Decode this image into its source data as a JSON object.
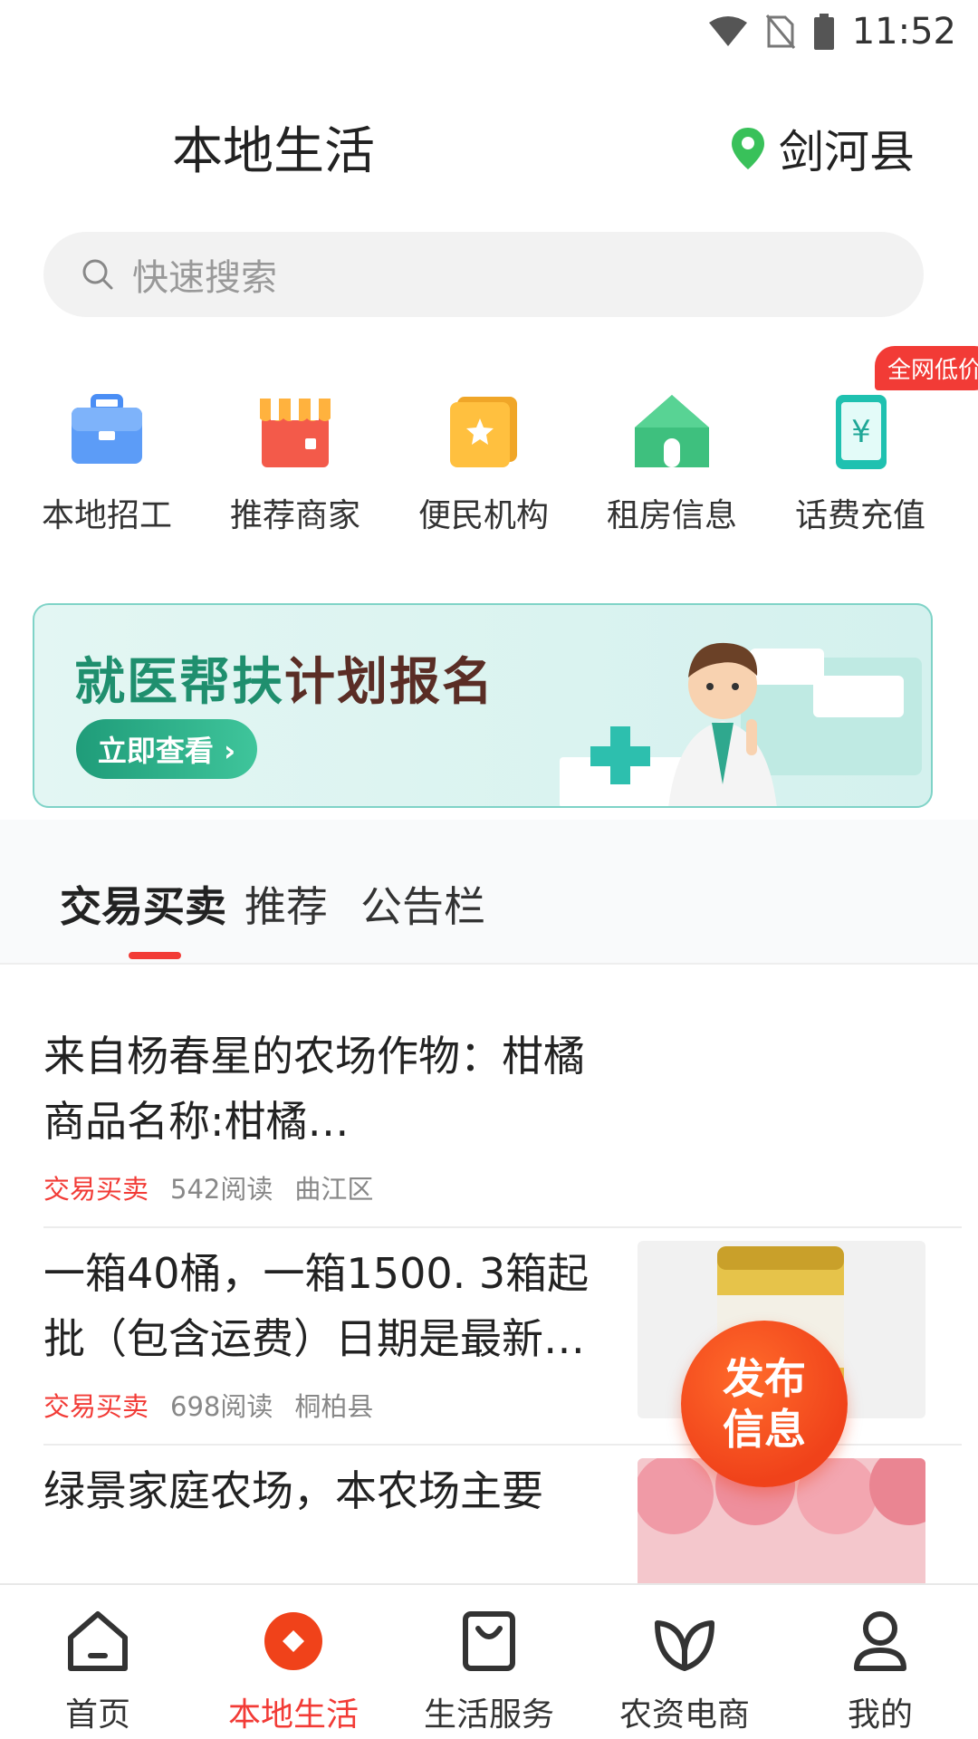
{
  "status_bar": {
    "time": "11:52"
  },
  "header": {
    "title": "本地生活",
    "location": "剑河县"
  },
  "search": {
    "placeholder": "快速搜索"
  },
  "quick_links": [
    {
      "label": "本地招工",
      "icon": "briefcase-icon"
    },
    {
      "label": "推荐商家",
      "icon": "storefront-icon"
    },
    {
      "label": "便民机构",
      "icon": "star-bookmark-icon"
    },
    {
      "label": "租房信息",
      "icon": "house-icon"
    },
    {
      "label": "话费充值",
      "icon": "phone-yuan-icon",
      "badge": "全网低价"
    }
  ],
  "banner": {
    "title_part1": "就医帮扶",
    "title_part2": "计划报名",
    "button": "立即查看 ›"
  },
  "tabs": [
    {
      "label": "交易买卖",
      "active": true
    },
    {
      "label": "推荐",
      "active": false
    },
    {
      "label": "公告栏",
      "active": false
    }
  ],
  "feed": [
    {
      "title": "来自杨春星的农场作物：柑橘商品名称:柑橘…",
      "tag": "交易买卖",
      "reads": "542阅读",
      "location": "曲江区"
    },
    {
      "title": "一箱40桶，一箱1500. 3箱起批（包含运费）日期是最新…",
      "tag": "交易买卖",
      "reads": "698阅读",
      "location": "桐柏县"
    },
    {
      "title": "绿景家庭农场，本农场主要"
    }
  ],
  "fab": {
    "label": "发布信息"
  },
  "bottom_nav": [
    {
      "label": "首页",
      "icon": "home-icon",
      "active": false
    },
    {
      "label": "本地生活",
      "icon": "local-life-icon",
      "active": true
    },
    {
      "label": "生活服务",
      "icon": "shopping-bag-icon",
      "active": false
    },
    {
      "label": "农资电商",
      "icon": "leaf-icon",
      "active": false
    },
    {
      "label": "我的",
      "icon": "user-icon",
      "active": false
    }
  ],
  "colors": {
    "accent": "#f23b36",
    "banner_green": "#1f8f6e",
    "fab_orange": "#f0421a"
  }
}
